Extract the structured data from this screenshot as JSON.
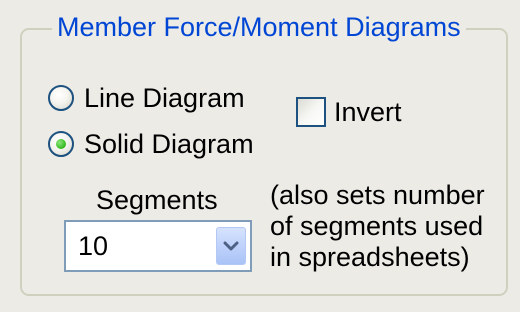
{
  "group": {
    "title": "Member Force/Moment Diagrams"
  },
  "diagram_type": {
    "options": [
      {
        "label": "Line Diagram",
        "selected": false
      },
      {
        "label": "Solid Diagram",
        "selected": true
      }
    ]
  },
  "invert": {
    "label": "Invert",
    "checked": false
  },
  "segments": {
    "label": "Segments",
    "value": "10",
    "note_lines": [
      "(also sets number",
      "of segments used",
      "in spreadsheets)"
    ]
  },
  "icons": {
    "dropdown": "chevron-down-icon"
  },
  "colors": {
    "group_title": "#0046d5",
    "radio_selected_dot": "#3fbf2b",
    "control_border": "#1c5180",
    "combo_border": "#7f9db9",
    "combo_button": "#bfd2fb",
    "background": "#ecebe6"
  }
}
